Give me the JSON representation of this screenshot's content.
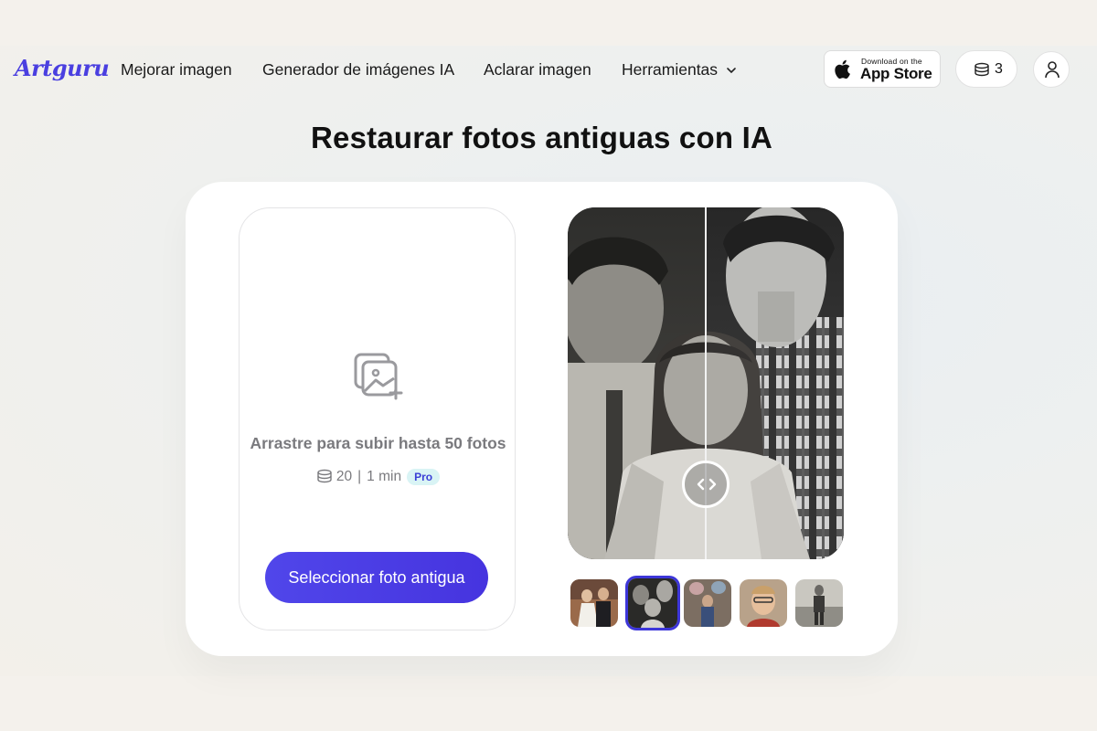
{
  "header": {
    "logo": "Artguru",
    "nav": [
      {
        "label": "Mejorar imagen"
      },
      {
        "label": "Generador de imágenes IA"
      },
      {
        "label": "Aclarar imagen"
      },
      {
        "label": "Herramientas"
      }
    ],
    "appstore": {
      "small": "Download on the",
      "big": "App Store"
    },
    "credits": "3"
  },
  "page_title": "Restaurar fotos antiguas con IA",
  "upload": {
    "prompt": "Arrastre para subir hasta 50 fotos",
    "cost": "20",
    "time": "1 min",
    "badge": "Pro",
    "button": "Seleccionar foto antigua"
  },
  "colors": {
    "accent": "#4a3fe0",
    "button": "#4b3ee6",
    "badge_bg": "#d9f4f5"
  },
  "icons": [
    "apple-icon",
    "chevron-down-icon",
    "coins-icon",
    "user-icon",
    "image-add-icon",
    "compare-arrows-icon"
  ]
}
